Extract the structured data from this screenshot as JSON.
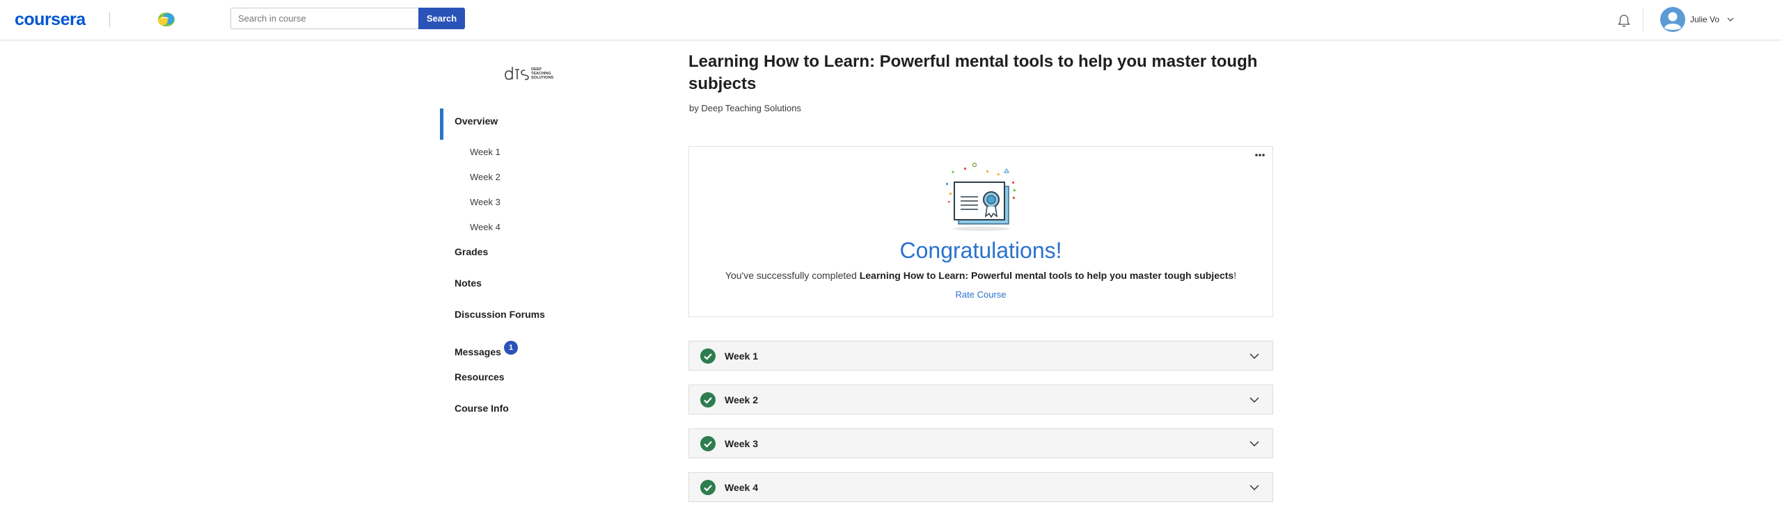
{
  "header": {
    "brand": "coursera",
    "search": {
      "placeholder": "Search in course",
      "value": ""
    },
    "search_button": "Search",
    "user": {
      "name": "Julie Vo"
    }
  },
  "sidebar": {
    "overview": "Overview",
    "weeks": [
      "Week 1",
      "Week 2",
      "Week 3",
      "Week 4"
    ],
    "grades": "Grades",
    "notes": "Notes",
    "forums": "Discussion Forums",
    "messages": "Messages",
    "messages_badge": "1",
    "resources": "Resources",
    "course_info": "Course Info"
  },
  "partner": {
    "logo_text": [
      "DEEP",
      "TEACHING",
      "SOLUTIONS"
    ]
  },
  "course": {
    "title": "Learning How to Learn: Powerful mental tools to help you master tough subjects",
    "byline": "by Deep Teaching Solutions"
  },
  "congrats": {
    "title": "Congratulations!",
    "prefix": "You've successfully completed ",
    "course_name": "Learning How to Learn: Powerful mental tools to help you master tough subjects",
    "suffix": "!",
    "rate": "Rate Course"
  },
  "weeks": [
    {
      "label": "Week 1",
      "completed": true
    },
    {
      "label": "Week 2",
      "completed": true
    },
    {
      "label": "Week 3",
      "completed": true
    },
    {
      "label": "Week 4",
      "completed": true
    }
  ],
  "colors": {
    "brand": "#0056d2",
    "accent": "#2a73cc",
    "button": "#2a53b8",
    "success": "#2e7d4f"
  }
}
